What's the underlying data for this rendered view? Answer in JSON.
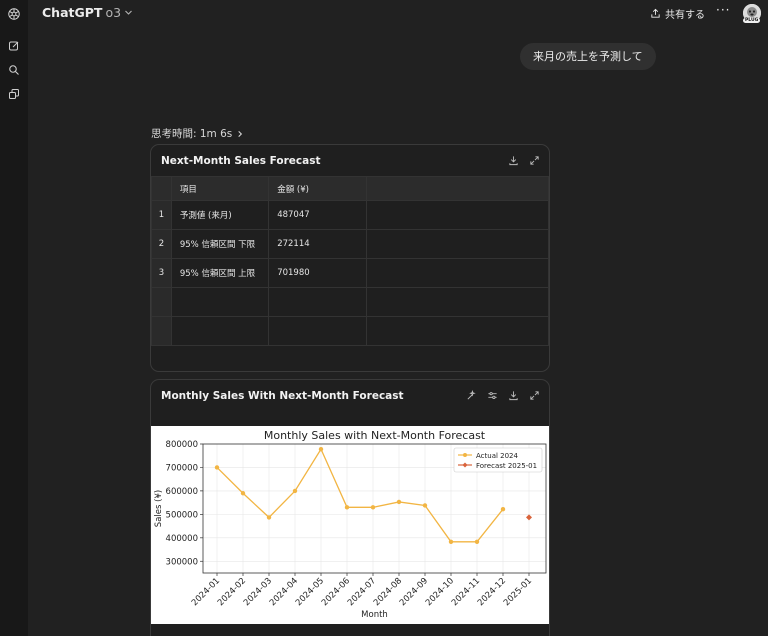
{
  "app": {
    "model_name": "ChatGPT",
    "model_version": "o3",
    "share_label": "共有する",
    "more_label": "···",
    "avatar_badge": "PLUG"
  },
  "rail": {
    "icons": [
      "openai-logo-icon",
      "new-chat-icon",
      "search-icon",
      "library-icon"
    ]
  },
  "conversation": {
    "user_message": "来月の売上を予測して",
    "thinking_label": "思考時間: 1m 6s"
  },
  "table_card": {
    "title": "Next-Month Sales Forecast",
    "columns": [
      "項目",
      "金額 (¥)"
    ],
    "rows": [
      {
        "index": "1",
        "item": "予測値 (来月)",
        "amount": "487047"
      },
      {
        "index": "2",
        "item": "95% 信頼区間 下限",
        "amount": "272114"
      },
      {
        "index": "3",
        "item": "95% 信頼区間 上限",
        "amount": "701980"
      }
    ]
  },
  "chart_card": {
    "title": "Monthly Sales With Next-Month Forecast"
  },
  "chart_data": {
    "type": "line",
    "title": "Monthly Sales with Next-Month Forecast",
    "xlabel": "Month",
    "ylabel": "Sales (¥)",
    "ylim": [
      250000,
      800000
    ],
    "yticks": [
      300000,
      400000,
      500000,
      600000,
      700000,
      800000
    ],
    "ytick_labels": [
      "300000",
      "400000",
      "500000",
      "600000",
      "700000",
      "800000"
    ],
    "categories": [
      "2024-01",
      "2024-02",
      "2024-03",
      "2024-04",
      "2024-05",
      "2024-06",
      "2024-07",
      "2024-08",
      "2024-09",
      "2024-10",
      "2024-11",
      "2024-12",
      "2025-01"
    ],
    "grid": true,
    "legend": "top-right",
    "series": [
      {
        "name": "Actual 2024",
        "color": "#f2b543",
        "marker": "circle",
        "values": [
          700000,
          590000,
          487000,
          600000,
          778000,
          530000,
          530000,
          553000,
          538000,
          383000,
          383000,
          522000,
          null
        ]
      },
      {
        "name": "Forecast 2025-01",
        "color": "#d9633b",
        "marker": "diamond",
        "values": [
          null,
          null,
          null,
          null,
          null,
          null,
          null,
          null,
          null,
          null,
          null,
          null,
          487047
        ]
      }
    ]
  }
}
